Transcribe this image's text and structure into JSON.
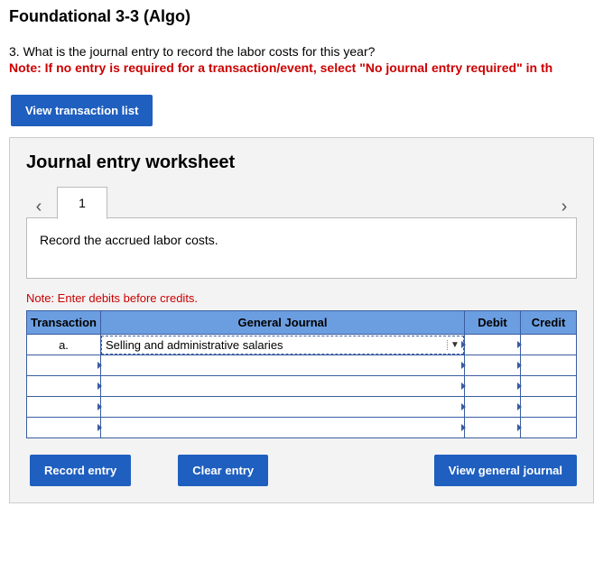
{
  "title": "Foundational 3-3 (Algo)",
  "question": "3. What is the journal entry to record the labor costs for this year?",
  "note_red": "Note: If no entry is required for a transaction/event, select \"No journal entry required\" in th",
  "view_transaction_list": "View transaction list",
  "worksheet_title": "Journal entry worksheet",
  "tab_number": "1",
  "instruction": "Record the accrued labor costs.",
  "debits_note": "Note: Enter debits before credits.",
  "headers": {
    "transaction": "Transaction",
    "general_journal": "General Journal",
    "debit": "Debit",
    "credit": "Credit"
  },
  "rows": [
    {
      "tx": "a.",
      "gj": "Selling and administrative salaries",
      "debit": "",
      "credit": ""
    },
    {
      "tx": "",
      "gj": "",
      "debit": "",
      "credit": ""
    },
    {
      "tx": "",
      "gj": "",
      "debit": "",
      "credit": ""
    },
    {
      "tx": "",
      "gj": "",
      "debit": "",
      "credit": ""
    },
    {
      "tx": "",
      "gj": "",
      "debit": "",
      "credit": ""
    }
  ],
  "buttons": {
    "record": "Record entry",
    "clear": "Clear entry",
    "view_journal": "View general journal"
  }
}
